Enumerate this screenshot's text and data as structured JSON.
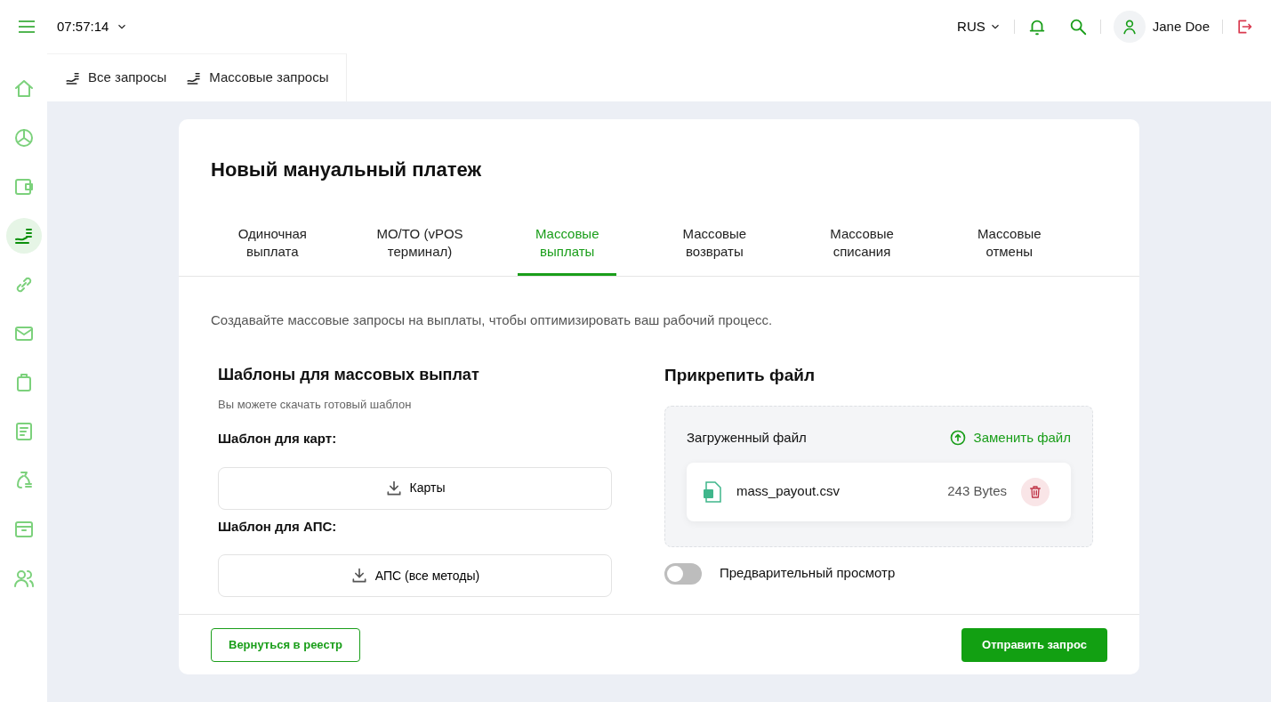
{
  "header": {
    "time": "07:57:14",
    "language": "RUS",
    "user": "Jane Doe"
  },
  "sidebar": {
    "items": [
      {
        "selected": false
      },
      {
        "selected": false
      },
      {
        "selected": false
      },
      {
        "selected": true
      },
      {
        "selected": false
      },
      {
        "selected": false
      },
      {
        "selected": false
      },
      {
        "selected": false
      },
      {
        "selected": false
      },
      {
        "selected": false
      },
      {
        "selected": false
      }
    ]
  },
  "subnav": [
    {
      "label": "Все запросы"
    },
    {
      "label": "Массовые запросы"
    }
  ],
  "card": {
    "title": "Новый мануальный платеж",
    "tabs": [
      {
        "label": "Одиночная выплата",
        "selected": false
      },
      {
        "label": "MO/TO (vPOS терминал)",
        "selected": false
      },
      {
        "label": "Массовые выплаты",
        "selected": true
      },
      {
        "label": "Массовые возвраты",
        "selected": false
      },
      {
        "label": "Массовые списания",
        "selected": false
      },
      {
        "label": "Массовые отмены",
        "selected": false
      }
    ],
    "description": "Создавайте массовые запросы на выплаты, чтобы оптимизировать ваш рабочий процесс.",
    "templates": {
      "title": "Шаблоны для массовых выплат",
      "hint": "Вы можете скачать готовый шаблон",
      "groups": [
        {
          "label": "Шаблон для карт:",
          "button": "Карты"
        },
        {
          "label": "Шаблон для АПС:",
          "button": "АПС (все методы)"
        }
      ]
    },
    "attach": {
      "title": "Прикрепить файл",
      "uploaded_label": "Загруженный файл",
      "replace": "Заменить файл",
      "file": {
        "name": "mass_payout.csv",
        "size": "243 Bytes"
      },
      "preview": {
        "label": "Предварительный просмотр",
        "on": false
      }
    },
    "back_button": "Вернуться в реестр",
    "submit_button": "Отправить запрос"
  }
}
